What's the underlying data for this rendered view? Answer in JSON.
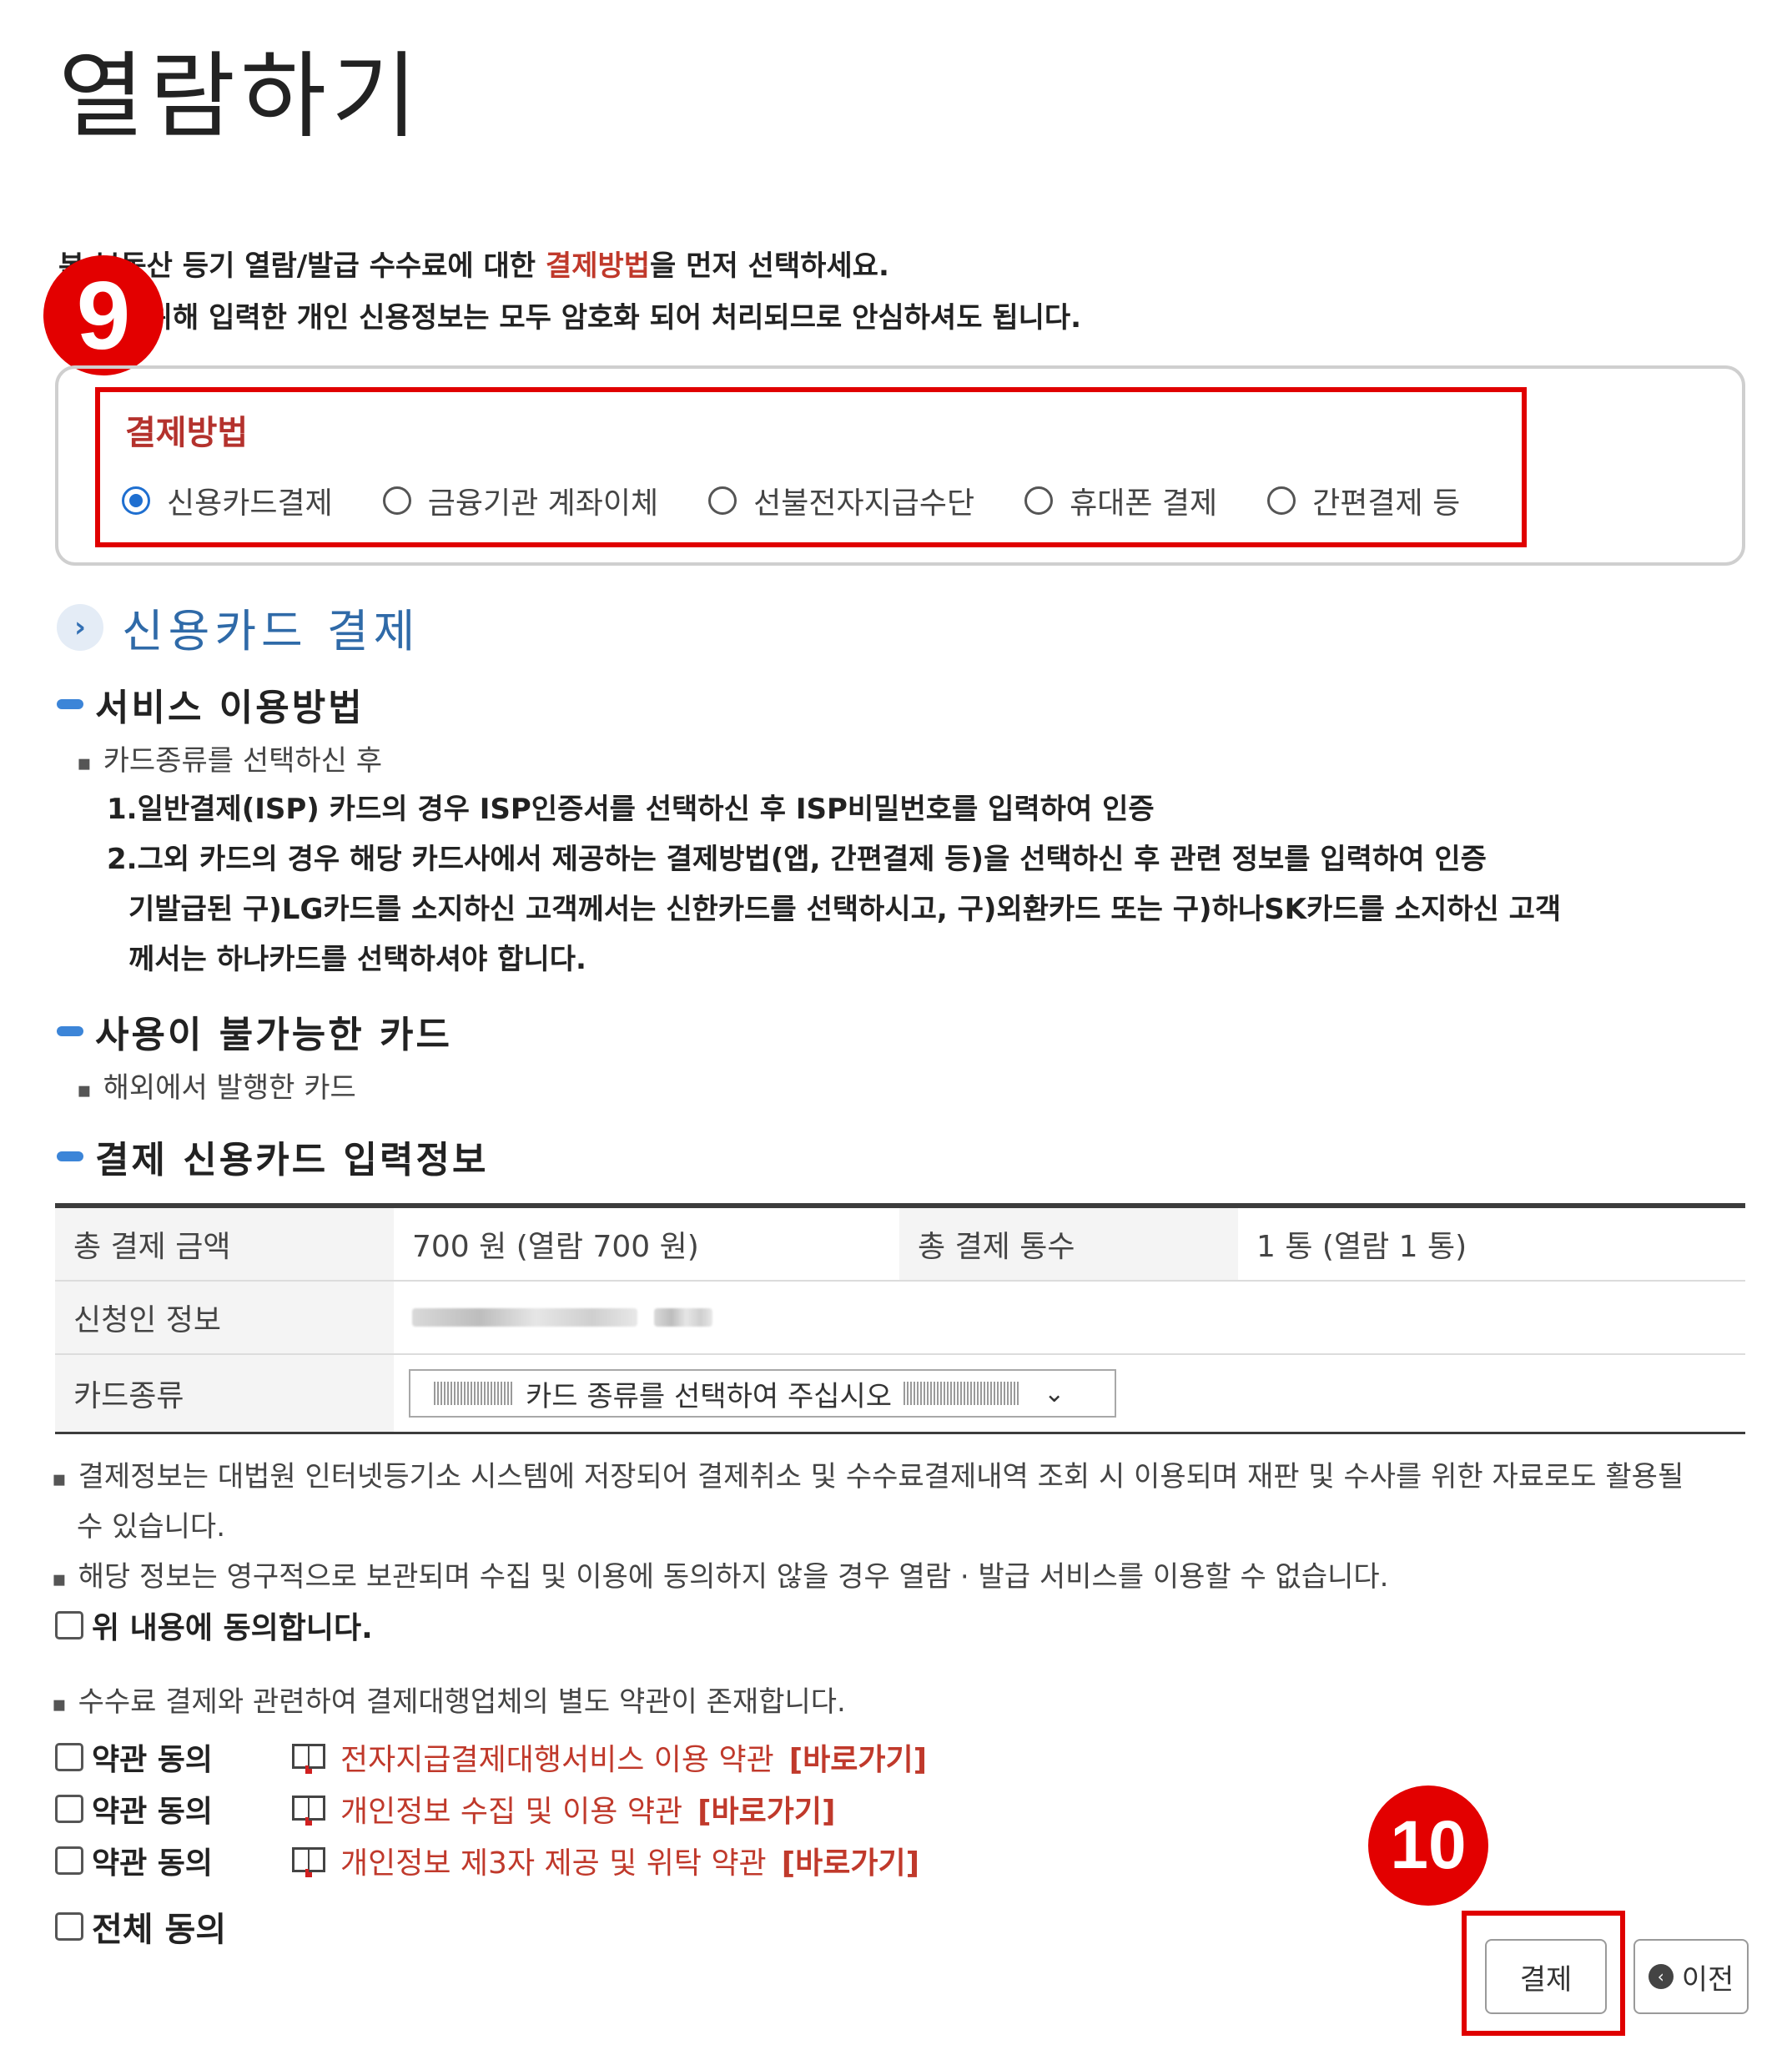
{
  "page_title": "열람하기",
  "intro": {
    "line1_pre": "본 부동산 등기 열람/발급 수수료에 대한 ",
    "line1_hl": "결제방법",
    "line1_post": "을 먼저 선택하세요.",
    "line2": "결제를 위해 입력한 개인 신용정보는 모두 암호화 되어 처리되므로 안심하셔도 됩니다."
  },
  "badges": {
    "step9": "9",
    "step10": "10"
  },
  "payment_method": {
    "title": "결제방법",
    "options": [
      "신용카드결제",
      "금융기관 계좌이체",
      "선불전자지급수단",
      "휴대폰 결제",
      "간편결제 등"
    ],
    "selected": "신용카드결제"
  },
  "section_title": "신용카드 결제",
  "service_usage": {
    "title": "서비스 이용방법",
    "bullet": "카드종류를 선택하신 후",
    "step1": "1.일반결제(ISP) 카드의 경우 ISP인증서를 선택하신 후 ISP비밀번호를 입력하여 인증",
    "step2": "2.그외 카드의 경우 해당 카드사에서 제공하는 결제방법(앱, 간편결제 등)을 선택하신 후 관련 정보를 입력하여 인증",
    "note1": "기발급된 구)LG카드를 소지하신 고객께서는 신한카드를 선택하시고, 구)외환카드 또는 구)하나SK카드를 소지하신 고객",
    "note2": "께서는 하나카드를 선택하셔야 합니다."
  },
  "unavailable_cards": {
    "title": "사용이 불가능한 카드",
    "bullet": "해외에서 발행한 카드"
  },
  "card_input": {
    "title": "결제 신용카드 입력정보",
    "total_amount_label": "총 결제 금액",
    "total_amount_value": "700 원 (열람 700 원)",
    "total_count_label": "총 결제 통수",
    "total_count_value": "1 통 (열람 1 통)",
    "applicant_label": "신청인 정보",
    "card_type_label": "카드종류",
    "card_type_select": "카드 종류를 선택하여 주십시오"
  },
  "notices": {
    "n1a": "결제정보는 대법원 인터넷등기소 시스템에 저장되어 결제취소 및 수수료결제내역 조회 시 이용되며 재판 및 수사를 위한 자료로도 활용될",
    "n1b": "수 있습니다.",
    "n2": "해당 정보는 영구적으로 보관되며 수집 및 이용에 동의하지 않을 경우 열람 · 발급 서비스를 이용할 수 없습니다.",
    "agree": "위 내용에 동의합니다.",
    "n3": "수수료 결제와 관련하여 결제대행업체의 별도 약관이 존재합니다."
  },
  "terms": [
    {
      "label": "약관 동의",
      "name": "전자지급결제대행서비스 이용 약관",
      "go": "[바로가기]"
    },
    {
      "label": "약관 동의",
      "name": "개인정보 수집 및 이용 약관",
      "go": "[바로가기]"
    },
    {
      "label": "약관 동의",
      "name": "개인정보 제3자 제공 및 위탁 약관",
      "go": "[바로가기]"
    }
  ],
  "agree_all": "전체 동의",
  "buttons": {
    "pay": "결제",
    "prev": "이전"
  },
  "colors": {
    "highlight_red": "#e00000",
    "accent_blue": "#1f6fd0",
    "link_red": "#c0392b"
  }
}
